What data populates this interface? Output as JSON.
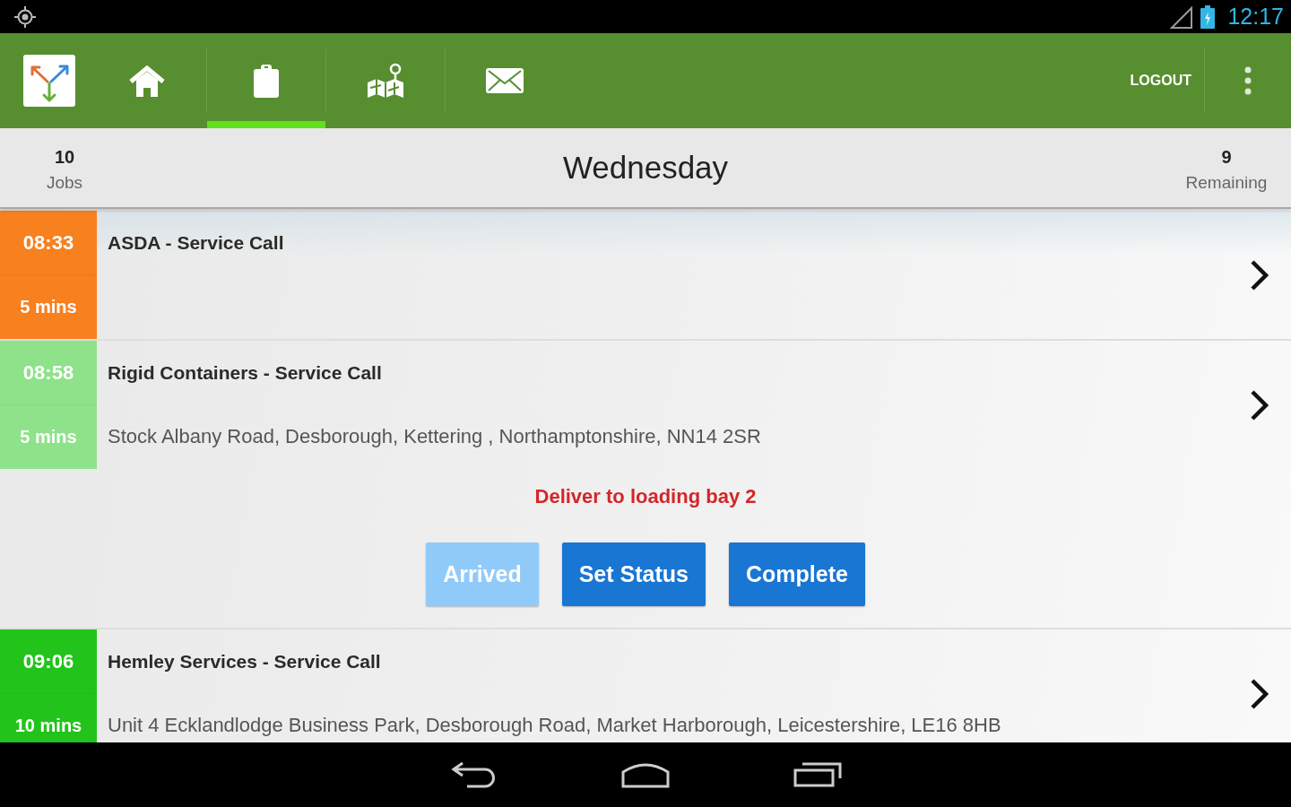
{
  "status_bar": {
    "time": "12:17"
  },
  "app_bar": {
    "tabs": [
      {
        "kind": "home",
        "selected": false
      },
      {
        "kind": "clipboard",
        "selected": true
      },
      {
        "kind": "map",
        "selected": false
      },
      {
        "kind": "mail",
        "selected": false
      }
    ],
    "logout": "LOGOUT"
  },
  "summary": {
    "jobs": {
      "count": "10",
      "label": "Jobs"
    },
    "day": "Wednesday",
    "remaining": {
      "count": "9",
      "label": "Remaining"
    }
  },
  "jobs": [
    {
      "time": "08:33",
      "duration": "5 mins",
      "color": "#f7801f",
      "title": "ASDA - Service Call"
    },
    {
      "time": "08:58",
      "duration": "5 mins",
      "color": "#8ee28a",
      "title": "Rigid Containers - Service Call",
      "address": "Stock Albany Road, Desborough, Kettering , Northamptonshire, NN14 2SR",
      "note": "Deliver to loading bay 2",
      "actions": [
        {
          "label": "Arrived",
          "disabled": true
        },
        {
          "label": "Set Status",
          "disabled": false
        },
        {
          "label": "Complete",
          "disabled": false
        }
      ]
    },
    {
      "time": "09:06",
      "duration": "10 mins",
      "color": "#22c41c",
      "title": "Hemley Services - Service Call",
      "address": "Unit 4 Ecklandlodge Business Park, Desborough Road, Market Harborough, Leicestershire, LE16 8HB"
    }
  ]
}
